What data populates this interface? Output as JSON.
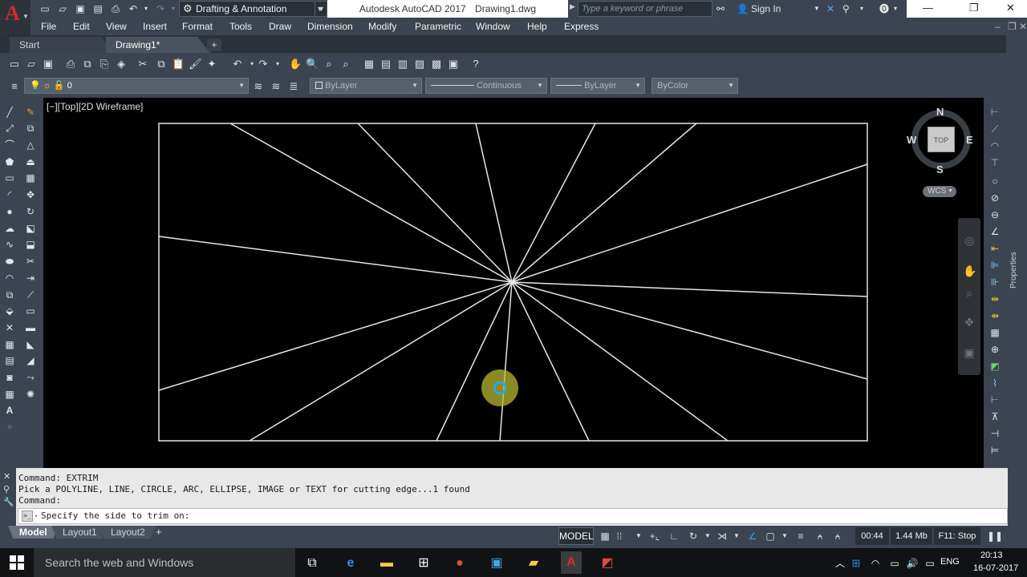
{
  "titlebar": {
    "workspace": "Drafting & Annotation",
    "app_title": "Autodesk AutoCAD 2017",
    "doc_name": "Drawing1.dwg",
    "search_placeholder": "Type a keyword or phrase",
    "sign_in": "Sign In"
  },
  "menubar": [
    "File",
    "Edit",
    "View",
    "Insert",
    "Format",
    "Tools",
    "Draw",
    "Dimension",
    "Modify",
    "Parametric",
    "Window",
    "Help",
    "Express"
  ],
  "tabs": {
    "start": "Start",
    "drawing": "Drawing1*",
    "plus": "+"
  },
  "layers": {
    "layer_value": "0",
    "color": "ByLayer",
    "linetype": "Continuous",
    "lineweight": "ByLayer",
    "plotstyle": "ByColor"
  },
  "viewport": {
    "label": "[−][Top][2D Wireframe]"
  },
  "viewcube": {
    "n": "N",
    "s": "S",
    "e": "E",
    "w": "W",
    "top": "TOP",
    "wcs": "WCS"
  },
  "properties_label": "Properties",
  "command": {
    "history": [
      "Command: EXTRIM",
      "Pick a POLYLINE, LINE, CIRCLE, ARC, ELLIPSE, IMAGE or TEXT for cutting edge...1 found",
      "Command:"
    ],
    "prompt": "Specify the side to trim on:"
  },
  "layout_tabs": {
    "model": "Model",
    "layout1": "Layout1",
    "layout2": "Layout2"
  },
  "status": {
    "model_btn": "MODEL",
    "time": "00:44",
    "memory": "1.44 Mb",
    "f11": "F11: Stop"
  },
  "taskbar": {
    "search_placeholder": "Search the web and Windows",
    "lang": "ENG",
    "clock_time": "20:13",
    "clock_date": "16-07-2017"
  },
  "colors": {
    "ribbon": "#3b4450",
    "canvas": "#000000",
    "command_bg": "#e8e8e8",
    "cursor_ring": "#2aa7e0",
    "cursor_glow": "#c8c832"
  }
}
